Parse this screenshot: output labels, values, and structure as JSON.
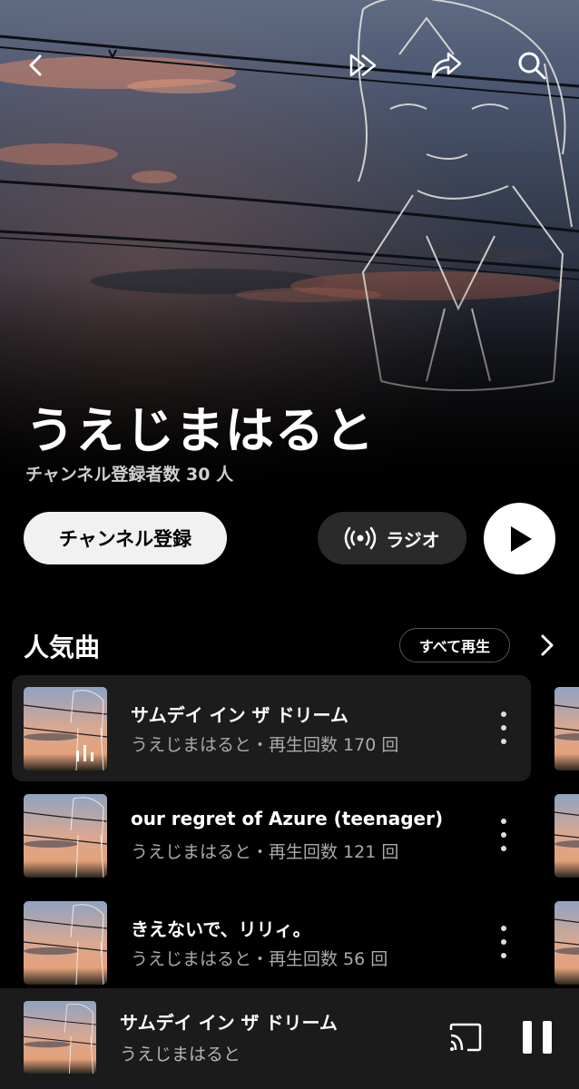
{
  "artist": {
    "name": "うえじまはると",
    "subscribers": "チャンネル登録者数 30 人"
  },
  "topbar": {
    "back_icon": "chevron-left-icon",
    "shuffle_icon": "shuffle-icon",
    "share_icon": "share-icon",
    "search_icon": "search-icon"
  },
  "actions": {
    "subscribe_label": "チャンネル登録",
    "radio_label": "ラジオ",
    "play_icon": "play-icon"
  },
  "popular": {
    "title": "人気曲",
    "play_all_label": "すべて再生",
    "songs": [
      {
        "title": "サムデイ イン ザ ドリーム",
        "meta": "うえじまはると・再生回数 170 回",
        "playing": true
      },
      {
        "title": "our regret of Azure (teenager)",
        "meta": "うえじまはると・再生回数 121 回",
        "playing": false
      },
      {
        "title": "きえないで、リリィ。",
        "meta": "うえじまはると・再生回数 56 回",
        "playing": false
      }
    ]
  },
  "now_playing": {
    "title": "サムデイ イン ザ ドリーム",
    "artist": "うえじまはると"
  },
  "colors": {
    "background": "#000000",
    "active_row": "#1c1c1c",
    "mini_player": "#1b1b1b",
    "button_light": "#f1f1f1",
    "button_dark": "#2a2a2a"
  }
}
